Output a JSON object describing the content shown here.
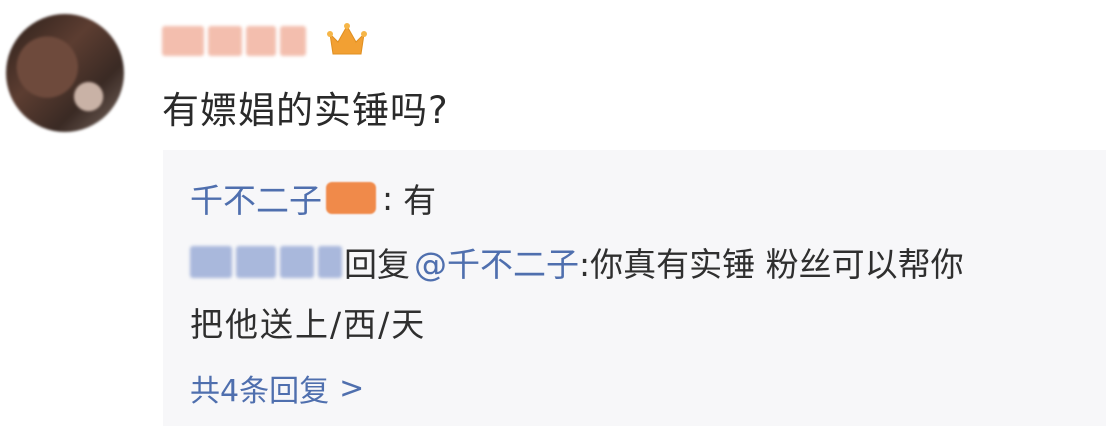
{
  "post": {
    "text": "有嫖娼的实锤吗?",
    "colors": {
      "text": "#2a2a2a",
      "link": "#4f6fae",
      "panel_bg": "#f7f7f9",
      "badge": "#f08a4a",
      "crown": "#f2a033"
    }
  },
  "replies": {
    "first": {
      "author": "千不二子",
      "separator": ":",
      "text": "有"
    },
    "second": {
      "reply_word": "回复",
      "mention": "@千不二子",
      "text_line1": ":你真有实锤 粉丝可以帮你",
      "text_line2": "把他送上/西/天"
    },
    "more_label": "共4条回复",
    "more_chevron": ">"
  },
  "icons": {
    "crown": "crown-icon",
    "avatar": "avatar",
    "chevron": "chevron-right-icon"
  }
}
